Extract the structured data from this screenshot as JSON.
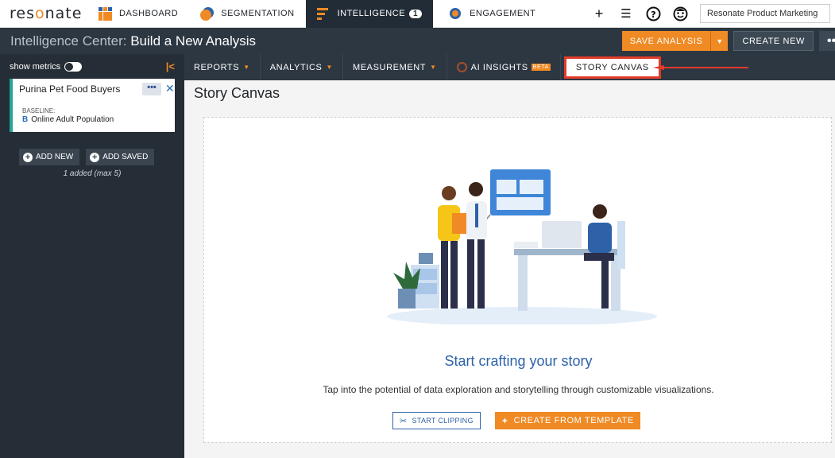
{
  "topnav": {
    "logo": "resonate",
    "tabs": [
      {
        "label": "DASHBOARD"
      },
      {
        "label": "SEGMENTATION"
      },
      {
        "label": "INTELLIGENCE",
        "badge": "1"
      },
      {
        "label": "ENGAGEMENT"
      }
    ],
    "org": "Resonate Product Marketing",
    "icons": [
      "plus-icon",
      "list-icon",
      "help-icon",
      "user-face-icon"
    ]
  },
  "titlebar": {
    "prefix": "Intelligence Center:",
    "title": "Build a New Analysis",
    "save_label": "SAVE ANALYSIS",
    "create_label": "CREATE NEW",
    "more_label": "••"
  },
  "sidebar": {
    "show_metrics": "show metrics",
    "collapse": "|<",
    "card": {
      "title": "Purina Pet Food Buyers",
      "dots": "•••",
      "close": "✕",
      "baseline_label": "BASELINE:",
      "baseline_icon": "B",
      "baseline_value": "Online Adult Population"
    },
    "add_new": "ADD NEW",
    "add_saved": "ADD SAVED",
    "note": "1 added (max 5)"
  },
  "subtabs": {
    "reports": "REPORTS",
    "analytics": "ANALYTICS",
    "measurement": "MEASUREMENT",
    "ai_insights": "AI INSIGHTS",
    "beta": "BETA",
    "story_canvas": "STORY CANVAS"
  },
  "main": {
    "title": "Story Canvas",
    "headline": "Start crafting your story",
    "subline": "Tap into the potential of data exploration and storytelling through customizable visualizations.",
    "start_clipping": "START CLIPPING",
    "create_template": "CREATE FROM TEMPLATE"
  },
  "colors": {
    "accent": "#f08a24",
    "dark": "#2c3742",
    "link": "#2d62a8",
    "highlight": "#e23b2a"
  }
}
